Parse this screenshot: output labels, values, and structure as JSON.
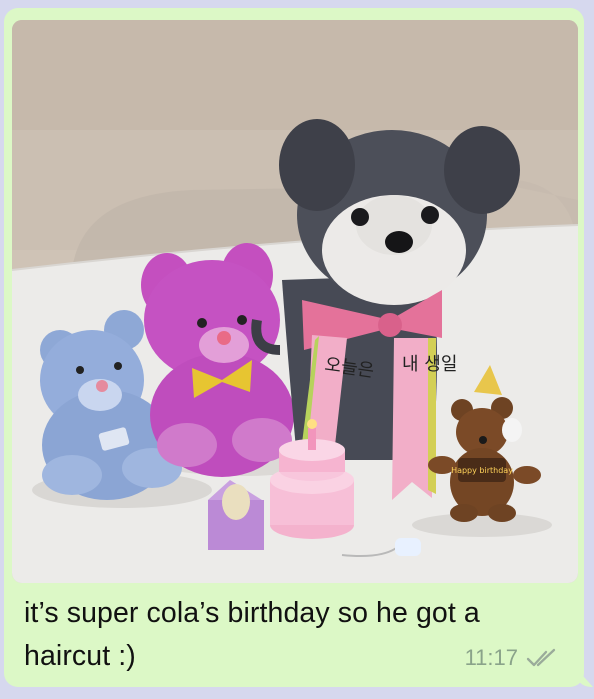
{
  "message": {
    "text": "it’s super cola’s birthday so he got a haircut :)",
    "time": "11:17",
    "status_icon": "double-check-icon",
    "photo": {
      "ribbon_left": "오늘은",
      "ribbon_right": "내 생일",
      "bear_shirt": "Happy birthday"
    }
  },
  "colors": {
    "bubble": "#dcf8c6",
    "background": "#d6d8ee",
    "time": "#8aa38a"
  }
}
